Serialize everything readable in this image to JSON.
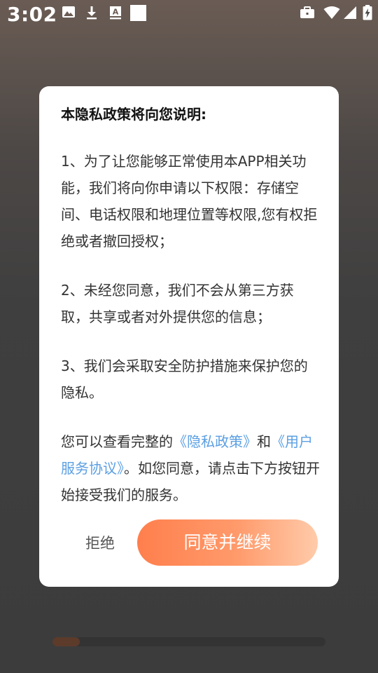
{
  "status_bar": {
    "time": "3:02",
    "left_icons": [
      "image-icon",
      "download-icon",
      "font-icon",
      "square-icon"
    ],
    "right_icons": [
      "briefcase-icon",
      "wifi-icon",
      "signal-icon",
      "battery-charging-icon"
    ]
  },
  "dialog": {
    "title": "本隐私政策将向您说明:",
    "para1": "1、为了让您能够正常使用本APP相关功能，我们将向你申请以下权限：存储空间、电话权限和地理位置等权限,您有权拒绝或者撤回授权；",
    "para2": "2、未经您同意，我们不会从第三方获取，共享或者对外提供您的信息；",
    "para3": "3、我们会采取安全防护措施来保护您的隐私。",
    "para4": {
      "prefix": "您可以查看完整的",
      "privacy_link": "《隐私政策》",
      "and": "和",
      "service_link": "《用户服务协议》",
      "suffix": "。如您同意，请点击下方按钮开始接受我们的服务。"
    },
    "reject_label": "拒绝",
    "agree_label": "同意并继续"
  },
  "progress": {
    "value": 0.1
  }
}
